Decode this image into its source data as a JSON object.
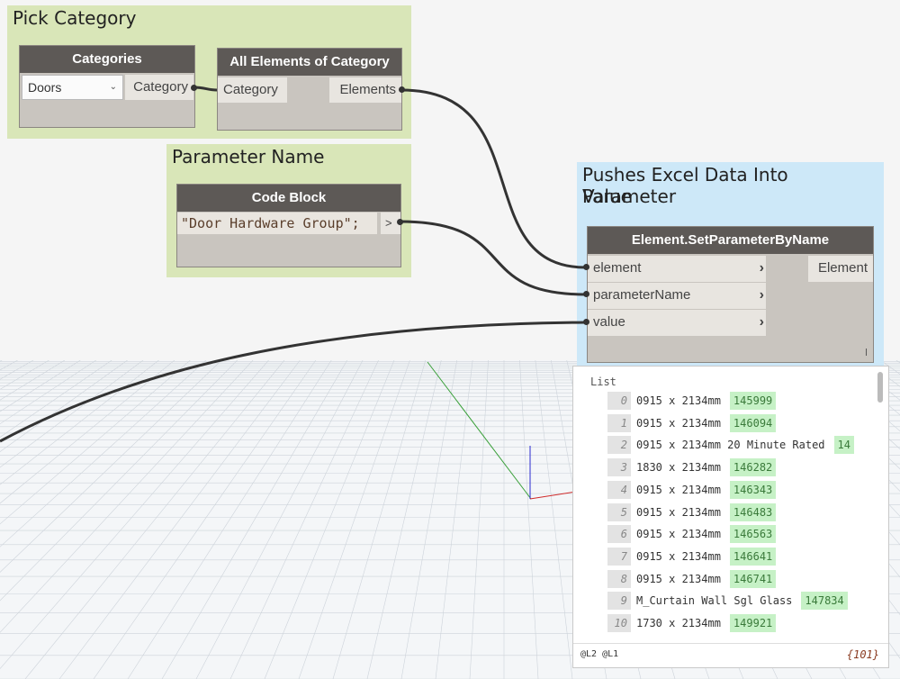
{
  "groups": {
    "pick_category": {
      "title": "Pick Category"
    },
    "parameter_name": {
      "title": "Parameter Name"
    },
    "pushes": {
      "title_line1": "Pushes Excel Data Into Parameter",
      "title_line2": "Value"
    }
  },
  "nodes": {
    "categories": {
      "title": "Categories",
      "dropdown_value": "Doors",
      "output": "Category"
    },
    "all_elements": {
      "title": "All Elements of Category",
      "input": "Category",
      "output": "Elements"
    },
    "code_block": {
      "title": "Code Block",
      "code": "\"Door Hardware Group\";",
      "output_glyph": ">"
    },
    "set_param": {
      "title": "Element.SetParameterByName",
      "inputs": [
        "element",
        "parameterName",
        "value"
      ],
      "output": "Element",
      "corner_mark": "l"
    }
  },
  "preview": {
    "label": "List",
    "rows": [
      {
        "index": "0",
        "name": "0915 x 2134mm",
        "value": "145999"
      },
      {
        "index": "1",
        "name": "0915 x 2134mm",
        "value": "146094"
      },
      {
        "index": "2",
        "name": "0915 x 2134mm 20 Minute Rated",
        "value": "14"
      },
      {
        "index": "3",
        "name": "1830 x 2134mm",
        "value": "146282"
      },
      {
        "index": "4",
        "name": "0915 x 2134mm",
        "value": "146343"
      },
      {
        "index": "5",
        "name": "0915 x 2134mm",
        "value": "146483"
      },
      {
        "index": "6",
        "name": "0915 x 2134mm",
        "value": "146563"
      },
      {
        "index": "7",
        "name": "0915 x 2134mm",
        "value": "146641"
      },
      {
        "index": "8",
        "name": "0915 x 2134mm",
        "value": "146741"
      },
      {
        "index": "9",
        "name": "M_Curtain Wall Sgl Glass",
        "value": "147834"
      },
      {
        "index": "10",
        "name": "1730 x 2134mm",
        "value": "149921"
      }
    ],
    "levels": "@L2 @L1",
    "count": "{101}"
  }
}
